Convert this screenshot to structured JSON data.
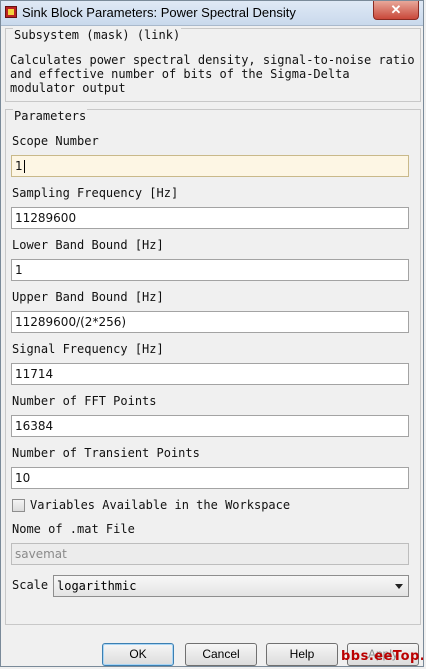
{
  "window": {
    "title": "Sink Block Parameters: Power Spectral Density",
    "close_glyph": "✕"
  },
  "mask": {
    "legend": "Subsystem (mask) (link)",
    "description": "Calculates power spectral density, signal-to-noise ratio and effective number of bits of the Sigma-Delta modulator output"
  },
  "parameters": {
    "legend": "Parameters",
    "scope_number": {
      "label": "Scope Number",
      "value": "1"
    },
    "sampling_frequency": {
      "label": "Sampling Frequency [Hz]",
      "value": "11289600"
    },
    "lower_band_bound": {
      "label": "Lower Band Bound [Hz]",
      "value": "1"
    },
    "upper_band_bound": {
      "label": "Upper Band Bound [Hz]",
      "value": "11289600/(2*256)"
    },
    "signal_frequency": {
      "label": "Signal Frequency [Hz]",
      "value": "11714"
    },
    "fft_points": {
      "label": "Number of FFT Points",
      "value": "16384"
    },
    "transient_points": {
      "label": "Number of Transient Points",
      "value": "10"
    },
    "workspace_checkbox": {
      "label": "Variables Available in the Workspace",
      "checked": false
    },
    "mat_file": {
      "label": "Nome of .mat File",
      "value": "savemat"
    },
    "scale": {
      "label": "Scale",
      "value": "logarithmic"
    }
  },
  "buttons": {
    "ok": "OK",
    "cancel": "Cancel",
    "help": "Help",
    "apply": "Apply"
  },
  "watermark": "bbs.eeTop.cn",
  "colors": {
    "watermark": "#b00000",
    "default_button_border": "#3c7fb1"
  },
  "icons": {
    "app": "simulink-block-icon",
    "close": "close-icon",
    "dropdown": "chevron-down-icon"
  }
}
